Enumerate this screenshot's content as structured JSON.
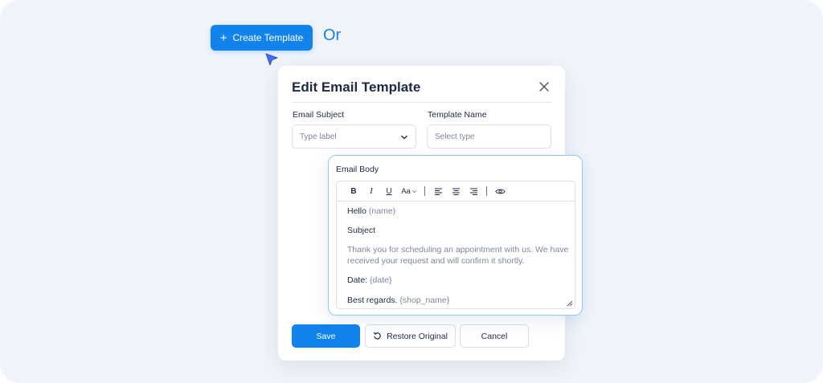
{
  "create_button": {
    "label": "Create Template",
    "icon": "plus-icon"
  },
  "or_label": "Or",
  "modal": {
    "title": "Edit Email Template",
    "close_icon": "close-icon",
    "subject": {
      "label": "Email Subject",
      "placeholder": "Type label"
    },
    "template_name": {
      "label": "Template Name",
      "placeholder": "Select type"
    },
    "buttons": {
      "save": "Save",
      "restore": "Restore Original",
      "cancel": "Cancel"
    }
  },
  "email_body": {
    "label": "Email Body",
    "toolbar": {
      "bold": "B",
      "italic": "I",
      "underline": "U",
      "font": "Aa"
    },
    "content": {
      "greeting": "Hello",
      "greeting_var": "(name)",
      "subject": "Subject",
      "paragraph": "Thank you for scheduling an appointment with us. We have received your request and will confirm it shortly.",
      "date_label": "Date:",
      "date_var": "{date}",
      "regards": "Best regards.",
      "shop_var": "{shop_name}"
    }
  },
  "colors": {
    "primary": "#1283ec",
    "background": "#f0f4fb",
    "accent_border": "#8fcbf6",
    "text": "#1e2a44",
    "muted": "#7d8799"
  }
}
